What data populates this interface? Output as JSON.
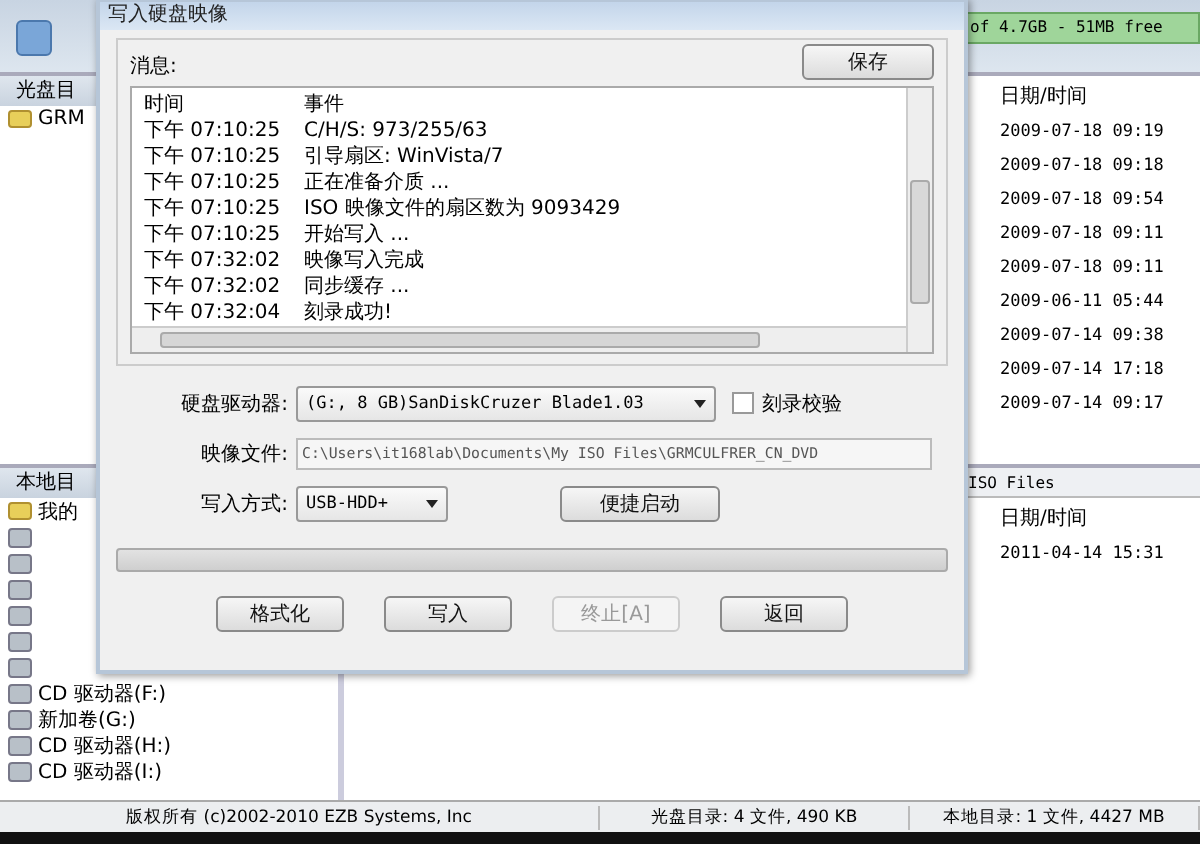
{
  "background_app": {
    "free_space": "of 4.7GB - 51MB free",
    "disc_panel": {
      "title": "光盘目",
      "tree": [
        {
          "label": "GRM"
        }
      ],
      "date_header": "日期/时间",
      "dates": [
        "2009-07-18 09:19",
        "2009-07-18 09:18",
        "2009-07-18 09:54",
        "2009-07-18 09:11",
        "2009-07-18 09:11",
        "2009-06-11 05:44",
        "2009-07-14 09:38",
        "2009-07-14 17:18",
        "2009-07-14 09:17"
      ]
    },
    "local_panel": {
      "title": "本地目",
      "tree": [
        {
          "label": "我的"
        },
        {
          "label": "CD 驱动器(F:)"
        },
        {
          "label": "新加卷(G:)"
        },
        {
          "label": "CD 驱动器(H:)"
        },
        {
          "label": "CD 驱动器(I:)"
        }
      ],
      "path": "ISO Files",
      "date_header": "日期/时间",
      "dates": [
        "2011-04-14 15:31"
      ]
    },
    "status_bar": [
      "版权所有 (c)2002-2010 EZB Systems, Inc",
      "光盘目录: 4 文件, 490 KB",
      "本地目录: 1 文件, 4427 MB"
    ]
  },
  "dialog": {
    "title": "写入硬盘映像",
    "messages_label": "消息:",
    "save_button": "保存",
    "log": {
      "columns": [
        "时间",
        "事件"
      ],
      "rows": [
        [
          "下午 07:10:25",
          "C/H/S: 973/255/63"
        ],
        [
          "下午 07:10:25",
          "引导扇区: WinVista/7"
        ],
        [
          "下午 07:10:25",
          "正在准备介质 ..."
        ],
        [
          "下午 07:10:25",
          "ISO 映像文件的扇区数为 9093429"
        ],
        [
          "下午 07:10:25",
          "开始写入 ..."
        ],
        [
          "下午 07:32:02",
          "映像写入完成"
        ],
        [
          "下午 07:32:02",
          "同步缓存 ..."
        ],
        [
          "下午 07:32:04",
          "刻录成功!"
        ]
      ]
    },
    "drive_label": "硬盘驱动器:",
    "drive_value": "(G:, 8 GB)SanDiskCruzer Blade1.03",
    "verify": {
      "label": "刻录校验",
      "checked": false
    },
    "image_label": "映像文件:",
    "image_value": "C:\\Users\\it168lab\\Documents\\My ISO Files\\GRMCULFRER_CN_DVD",
    "method_label": "写入方式:",
    "method_value": "USB-HDD+",
    "quick_boot_button": "便捷启动",
    "progress": {
      "level": 0
    },
    "buttons": [
      {
        "label": "格式化",
        "disabled": false
      },
      {
        "label": "写入",
        "disabled": false
      },
      {
        "label": "终止[A]",
        "disabled": true
      },
      {
        "label": "返回",
        "disabled": false
      }
    ]
  }
}
